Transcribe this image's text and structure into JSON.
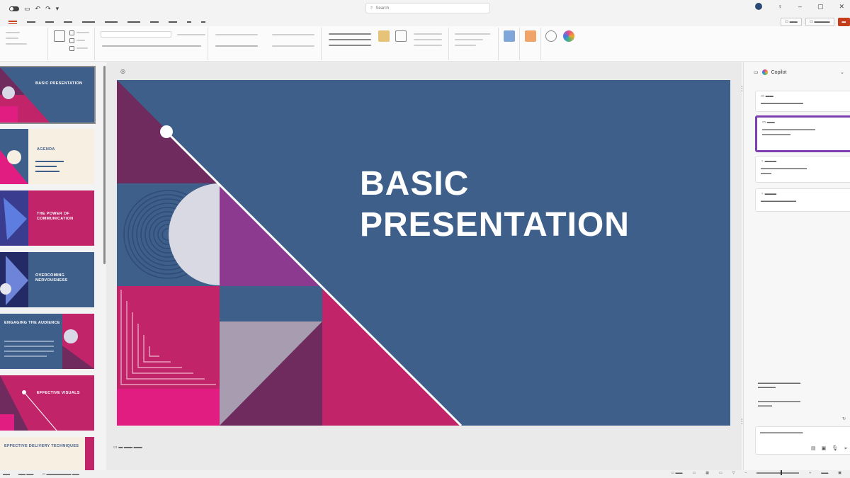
{
  "search": {
    "placeholder": "Search"
  },
  "slide": {
    "title_line1": "BASIC",
    "title_line2": "PRESENTATION"
  },
  "thumbnails": [
    {
      "title": "BASIC PRESENTATION"
    },
    {
      "title": "AGENDA"
    },
    {
      "title": "THE POWER OF COMMUNICATION"
    },
    {
      "title": "OVERCOMING NERVOUSNESS"
    },
    {
      "title": "ENGAGING THE AUDIENCE"
    },
    {
      "title": "EFFECTIVE VISUALS"
    },
    {
      "title": "EFFECTIVE DELIVERY TECHNIQUES"
    }
  ],
  "copilot": {
    "title": "Copilot"
  },
  "colors": {
    "slide_blue": "#3f5f8b",
    "magenta": "#c2246a",
    "plum": "#6f2a5e",
    "purple": "#8b3a8f",
    "hot_pink": "#e11d82",
    "accent_red": "#c43e1c",
    "copilot_selection": "#7b3fb0"
  },
  "icons": [
    "search-icon",
    "copilot-icon",
    "close-icon",
    "minimize-icon",
    "maximize-icon",
    "microphone-icon",
    "send-icon"
  ]
}
